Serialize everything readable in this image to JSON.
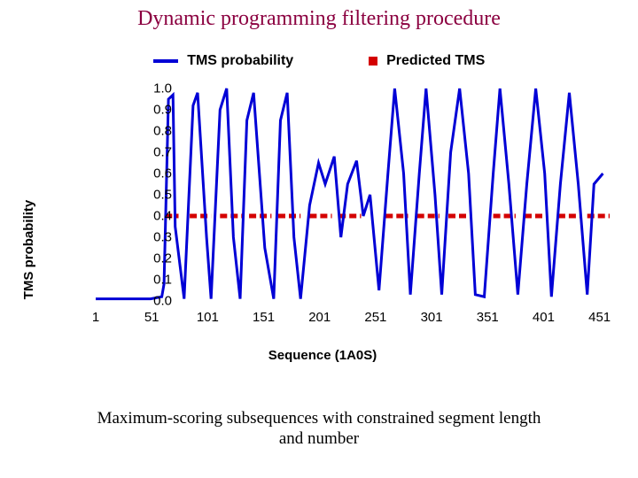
{
  "title": "Dynamic programming filtering procedure",
  "caption_line1": "Maximum-scoring subsequences with constrained segment length",
  "caption_line2": "and number",
  "legend": {
    "series1": "TMS probability",
    "series2": "Predicted TMS"
  },
  "ylabel": "TMS probability",
  "xlabel": "Sequence (1A0S)",
  "yticks": [
    "1.0",
    "0.9",
    "0.8",
    "0.7",
    "0.6",
    "0.5",
    "0.4",
    "0.3",
    "0.2",
    "0.1",
    "0.0"
  ],
  "xticks": [
    "1",
    "51",
    "101",
    "151",
    "201",
    "251",
    "301",
    "351",
    "401",
    "451"
  ],
  "chart_data": {
    "type": "line",
    "title": "Dynamic programming filtering procedure",
    "xlabel": "Sequence (1A0S)",
    "ylabel": "TMS probability",
    "xlim": [
      1,
      460
    ],
    "ylim": [
      0.0,
      1.0
    ],
    "series": [
      {
        "name": "TMS probability",
        "color": "#0000d6",
        "x": [
          1,
          10,
          20,
          30,
          40,
          50,
          60,
          62,
          66,
          70,
          72,
          80,
          88,
          92,
          100,
          104,
          112,
          118,
          124,
          130,
          136,
          142,
          152,
          160,
          166,
          172,
          178,
          184,
          192,
          200,
          206,
          214,
          220,
          226,
          234,
          240,
          246,
          254,
          262,
          268,
          276,
          282,
          290,
          296,
          304,
          310,
          318,
          326,
          334,
          340,
          348,
          356,
          362,
          370,
          378,
          386,
          394,
          402,
          408,
          416,
          424,
          432,
          440,
          446,
          454
        ],
        "y": [
          0.01,
          0.01,
          0.01,
          0.01,
          0.01,
          0.01,
          0.02,
          0.08,
          0.95,
          0.97,
          0.35,
          0.01,
          0.92,
          0.98,
          0.3,
          0.01,
          0.9,
          1.0,
          0.3,
          0.01,
          0.85,
          0.98,
          0.25,
          0.01,
          0.85,
          0.98,
          0.3,
          0.01,
          0.45,
          0.65,
          0.55,
          0.68,
          0.3,
          0.55,
          0.66,
          0.4,
          0.5,
          0.05,
          0.6,
          1.0,
          0.6,
          0.03,
          0.6,
          1.0,
          0.5,
          0.03,
          0.7,
          1.0,
          0.6,
          0.03,
          0.02,
          0.6,
          1.0,
          0.55,
          0.03,
          0.55,
          1.0,
          0.6,
          0.02,
          0.55,
          0.98,
          0.55,
          0.03,
          0.55,
          0.6
        ]
      },
      {
        "name": "Predicted TMS",
        "color": "#d40000",
        "type": "segments",
        "y": 0.4,
        "segments": [
          [
            63,
            75
          ],
          [
            85,
            104
          ],
          [
            112,
            132
          ],
          [
            138,
            158
          ],
          [
            164,
            184
          ],
          [
            192,
            212
          ],
          [
            218,
            238
          ],
          [
            260,
            280
          ],
          [
            288,
            308
          ],
          [
            316,
            336
          ],
          [
            356,
            376
          ],
          [
            384,
            404
          ],
          [
            414,
            434
          ],
          [
            440,
            460
          ]
        ]
      }
    ]
  }
}
